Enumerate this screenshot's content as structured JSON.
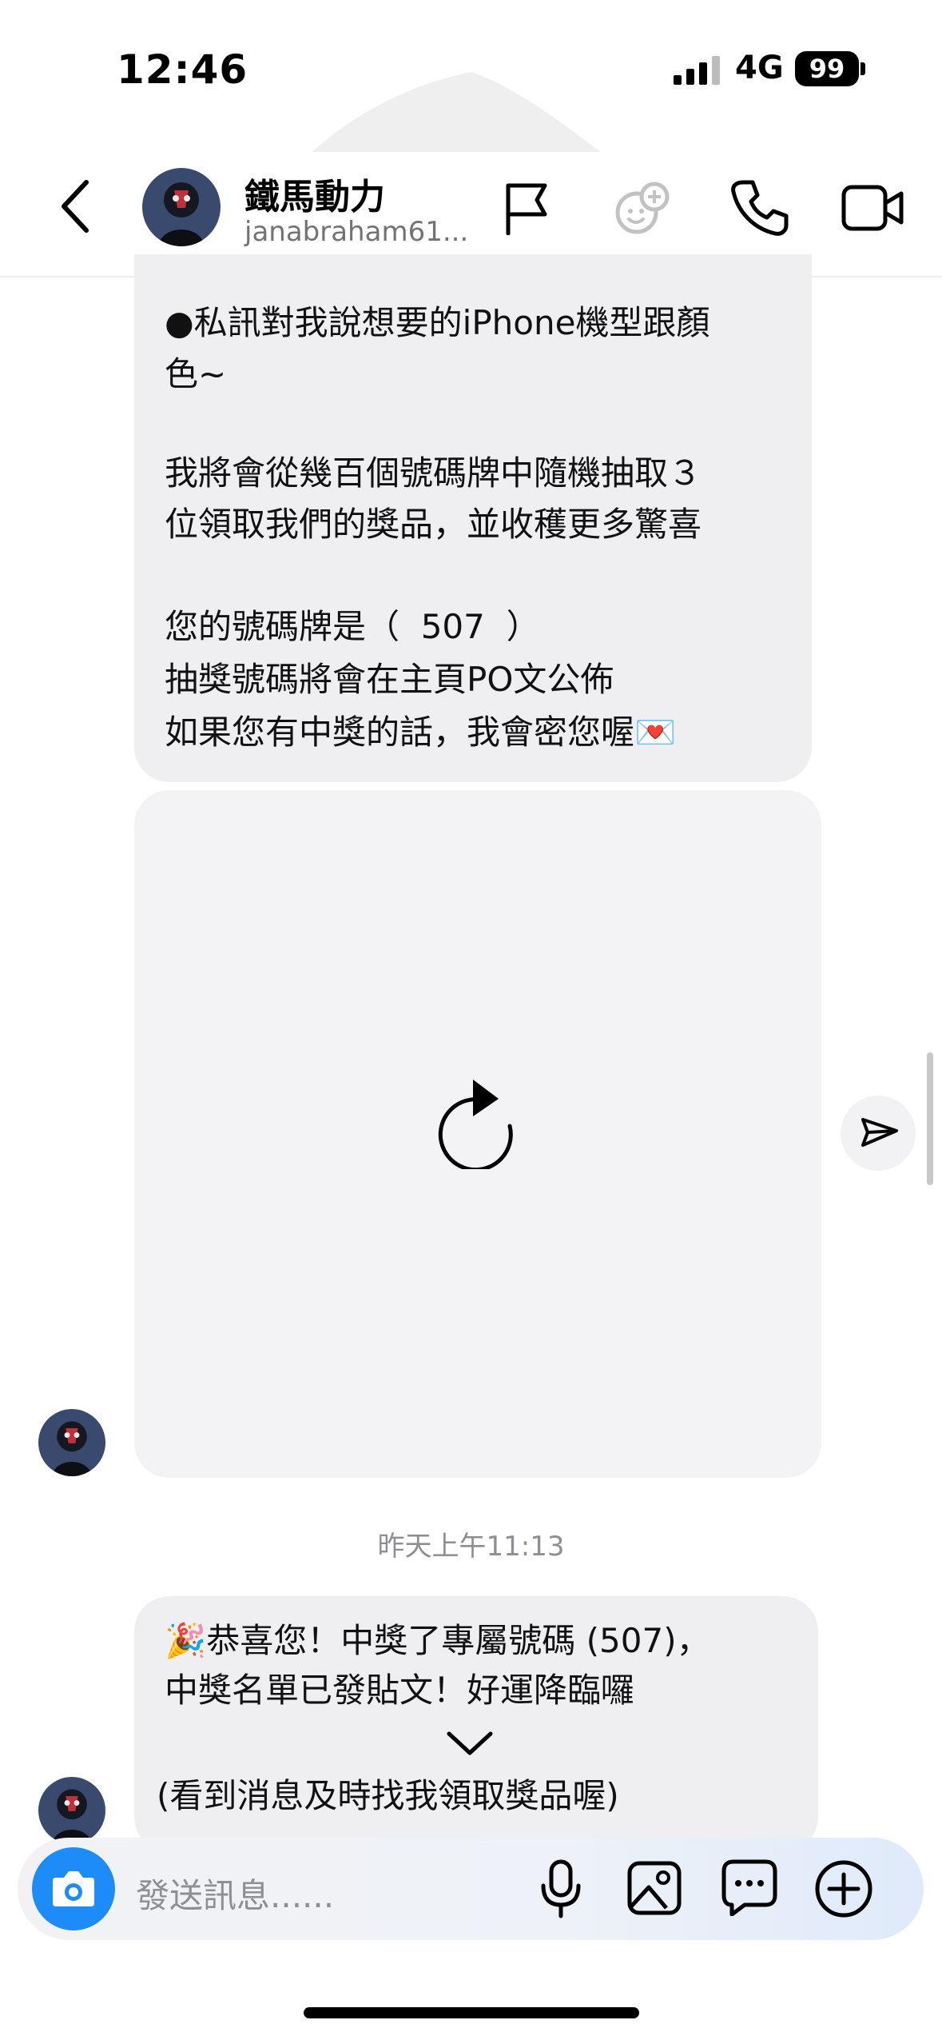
{
  "status_bar": {
    "time": "12:46",
    "network": "4G",
    "battery": "99"
  },
  "header": {
    "name": "鐵馬動力",
    "handle": "janabraham61...",
    "icons": [
      "back-icon",
      "flag-icon",
      "effects-icon",
      "phone-icon",
      "video-icon"
    ]
  },
  "messages": {
    "bubble1": {
      "line1": "●私訊對我說想要的iPhone機型跟顏",
      "line2": "色~",
      "line3": "我將會從幾百個號碼牌中隨機抽取３",
      "line4": "位領取我們的獎品，並收穫更多驚喜",
      "line5": "您的號碼牌是（  507  ）",
      "line6": "抽獎號碼將會在主頁PO文公佈",
      "line7": "如果您有中獎的話，我會密您喔💌"
    },
    "timestamp": "昨天上午11:13",
    "bubble2": {
      "line1": "🎉恭喜您！中獎了專屬號碼 (507)，",
      "line2": "中獎名單已發貼文！好運降臨囉",
      "line3": "(看到消息及時找我領取獎品喔)"
    }
  },
  "composer": {
    "placeholder": "發送訊息......"
  },
  "colors": {
    "accent": "#1d8cf8",
    "bubble": "#efeff2",
    "muted": "#8e8e93"
  }
}
